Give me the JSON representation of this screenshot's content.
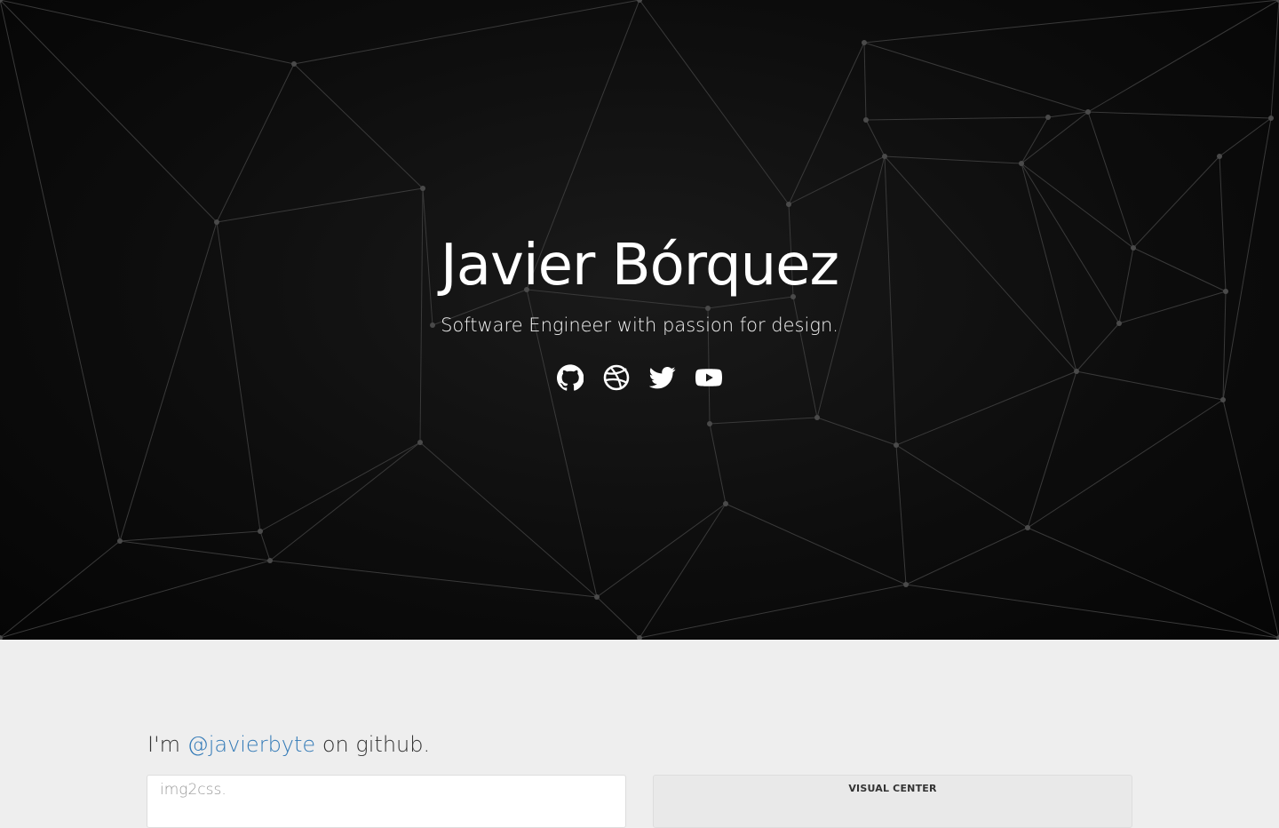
{
  "hero": {
    "title": "Javier Bórquez",
    "subtitle": "Software Engineer with passion for design.",
    "social": [
      {
        "name": "github",
        "icon": "github-icon"
      },
      {
        "name": "dribbble",
        "icon": "dribbble-icon"
      },
      {
        "name": "twitter",
        "icon": "twitter-icon"
      },
      {
        "name": "youtube",
        "icon": "youtube-icon"
      }
    ]
  },
  "github": {
    "prefix": "I'm ",
    "handle": "@javierbyte",
    "suffix": " on github."
  },
  "projects": [
    {
      "title": "img2css."
    },
    {
      "title": "VISUAL CENTER"
    }
  ],
  "colors": {
    "hero_bg": "#0d0d0d",
    "mesh_line": "#3a3a3a",
    "mesh_node": "#4a4a4a",
    "page_bg": "#eeeeee",
    "link": "#337ab7"
  }
}
